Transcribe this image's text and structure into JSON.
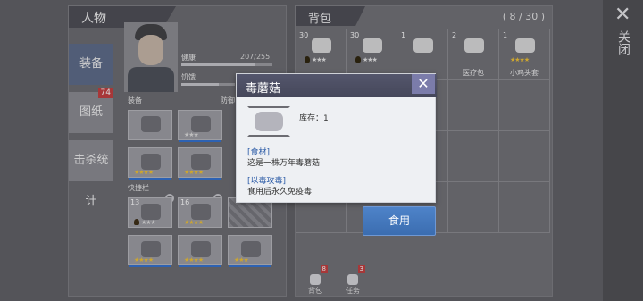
{
  "close_panel": {
    "label": "关闭"
  },
  "character": {
    "title": "人物",
    "tabs": [
      {
        "label": "装备"
      },
      {
        "label": "图纸",
        "badge": "74"
      },
      {
        "label": "击杀统计"
      }
    ],
    "stats": {
      "health_label": "健康",
      "health_value": "207/255",
      "hunger_label": "饥饿"
    },
    "equipment_label": "装备",
    "defense_label": "防御",
    "quickbar_label": "快捷栏",
    "quick_slot_counts": [
      "13",
      "16"
    ]
  },
  "backpack": {
    "title": "背包",
    "count": "( 8 / 30 )",
    "items": [
      {
        "num": "30",
        "name": ""
      },
      {
        "num": "30",
        "name": ""
      },
      {
        "num": "1",
        "name": ""
      },
      {
        "num": "2",
        "name": "医疗包"
      },
      {
        "num": "1",
        "name": "小鸡头套"
      }
    ],
    "tabs": [
      {
        "label": "背包",
        "badge": "8"
      },
      {
        "label": "任务",
        "badge": "3"
      }
    ]
  },
  "popup": {
    "title": "毒蘑菇",
    "stock": "库存：1",
    "category_label": "[食材]",
    "category_desc": "这是一株万年毒蘑菇",
    "effect_label": "[以毒攻毒]",
    "effect_desc": "食用后永久免疫毒",
    "use_button": "食用"
  },
  "icons": {
    "close": "close-icon",
    "popup_close": "popup-close-icon"
  },
  "colors": {
    "popup_header": "#4b4d61",
    "use_button": "#4778bd",
    "star": "#f2c230",
    "badge": "#c43b3b"
  }
}
